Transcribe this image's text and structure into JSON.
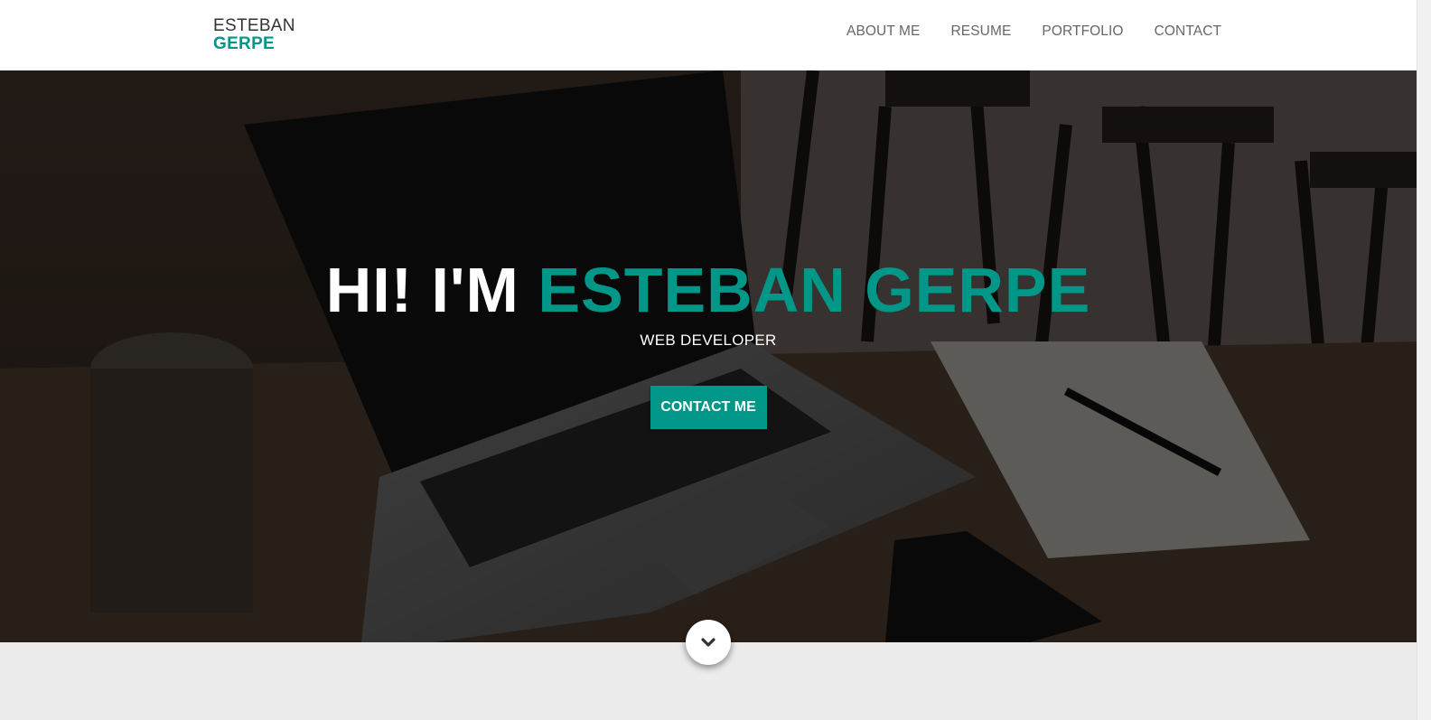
{
  "brand": {
    "first_name": "ESTEBAN",
    "last_name": "GERPE"
  },
  "nav": {
    "items": [
      "ABOUT ME",
      "RESUME",
      "PORTFOLIO",
      "CONTACT"
    ]
  },
  "hero": {
    "greeting": "HI! I'M",
    "name": "ESTEBAN GERPE",
    "subtitle": "WEB DEVELOPER",
    "cta_label": "CONTACT ME"
  },
  "icons": {
    "scroll_down": "chevron-down-icon"
  },
  "colors": {
    "accent": "#009688",
    "header_bg": "#ffffff",
    "section_bg": "#ececec"
  }
}
